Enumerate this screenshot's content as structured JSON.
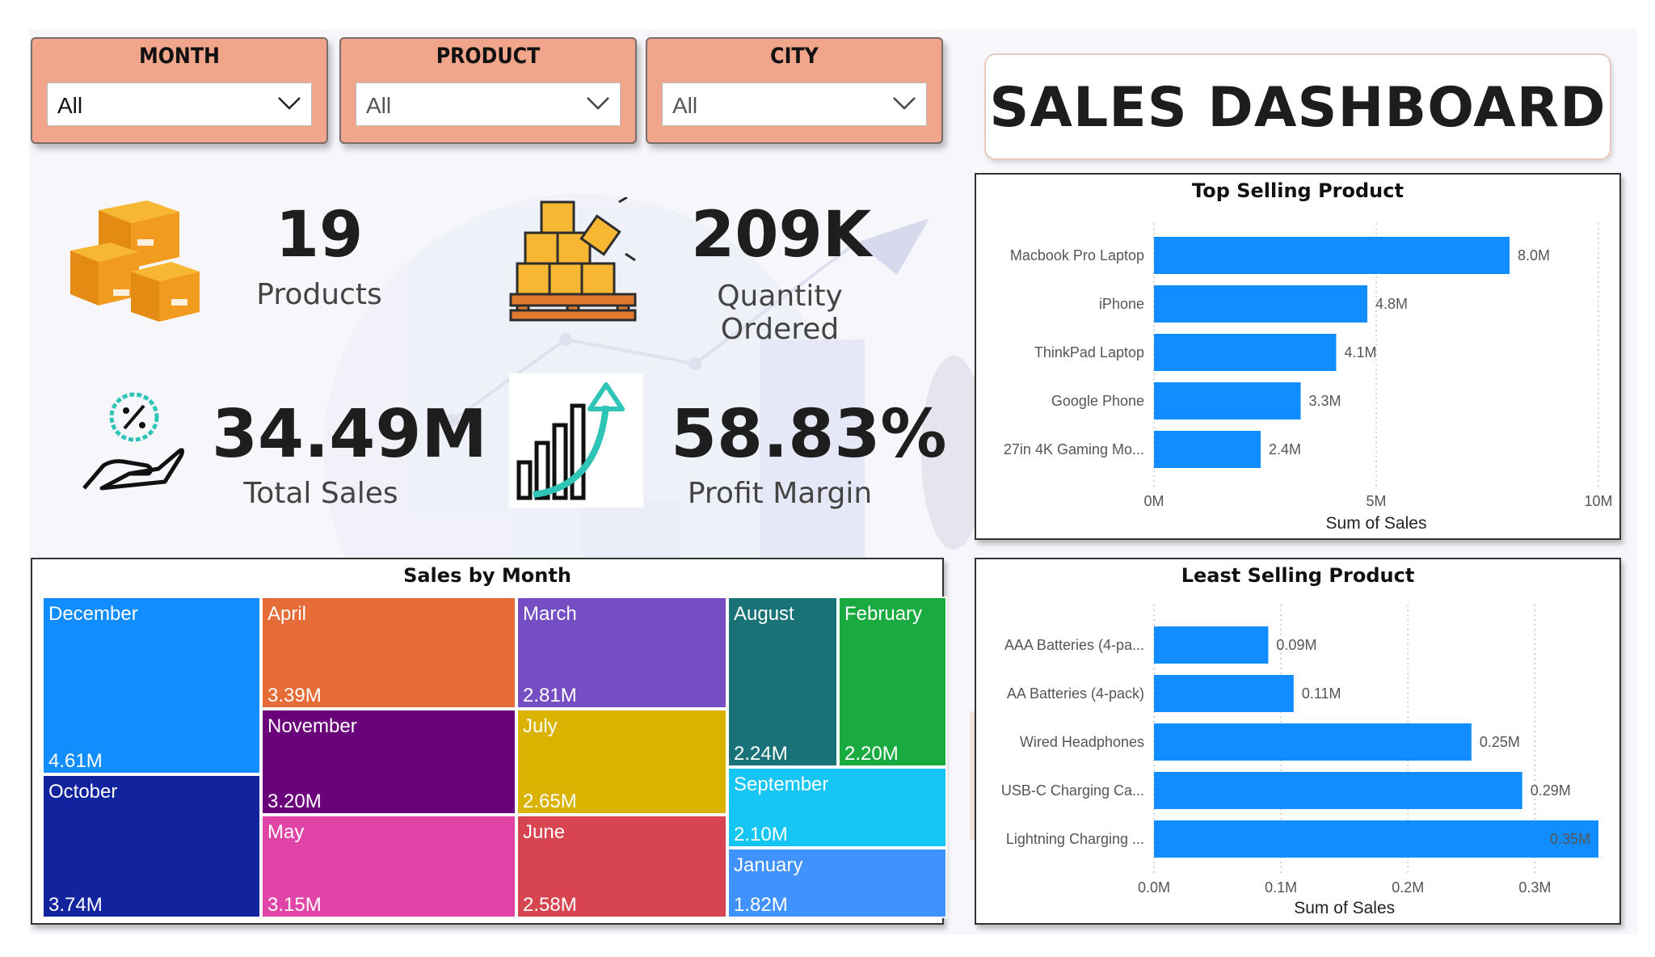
{
  "filters": [
    {
      "title": "MONTH",
      "value": "All"
    },
    {
      "title": "PRODUCT",
      "value": "All"
    },
    {
      "title": "CITY",
      "value": "All"
    }
  ],
  "dashboard_title": "SALES DASHBOARD",
  "kpis": {
    "products": {
      "value": "19",
      "label": "Products",
      "icon": "boxes-icon"
    },
    "quantity": {
      "value": "209K",
      "label": "Quantity Ordered",
      "icon": "pallet-boxes-icon"
    },
    "sales": {
      "value": "34.49M",
      "label": "Total Sales",
      "icon": "hand-percent-icon"
    },
    "margin": {
      "value": "58.83%",
      "label": "Profit Margin",
      "icon": "growth-chart-icon"
    }
  },
  "colors": {
    "accent": "#f1a58b",
    "bar": "#118dff"
  },
  "chart_data": [
    {
      "type": "bar",
      "orientation": "horizontal",
      "title": "Top Selling Product",
      "xlabel": "Sum of Sales",
      "categories": [
        "Macbook Pro Laptop",
        "iPhone",
        "ThinkPad Laptop",
        "Google Phone",
        "27in 4K Gaming Mo..."
      ],
      "values": [
        8.0,
        4.8,
        4.1,
        3.3,
        2.4
      ],
      "value_labels": [
        "8.0M",
        "4.8M",
        "4.1M",
        "3.3M",
        "2.4M"
      ],
      "xticks": [
        "0M",
        "5M",
        "10M"
      ],
      "xlim": [
        0,
        10
      ],
      "grid": true
    },
    {
      "type": "bar",
      "orientation": "horizontal",
      "title": "Least Selling Product",
      "xlabel": "Sum of Sales",
      "categories": [
        "AAA Batteries (4-pa...",
        "AA Batteries (4-pack)",
        "Wired Headphones",
        "USB-C Charging Ca...",
        "Lightning Charging ..."
      ],
      "values": [
        0.09,
        0.11,
        0.25,
        0.29,
        0.35
      ],
      "value_labels": [
        "0.09M",
        "0.11M",
        "0.25M",
        "0.29M",
        "0.35M"
      ],
      "xticks": [
        "0.0M",
        "0.1M",
        "0.2M",
        "0.3M"
      ],
      "xlim": [
        0,
        0.35
      ],
      "grid": true
    },
    {
      "type": "treemap",
      "title": "Sales by Month",
      "items": [
        {
          "name": "December",
          "label": "4.61M",
          "value": 4.61,
          "color": "#118dff"
        },
        {
          "name": "October",
          "label": "3.74M",
          "value": 3.74,
          "color": "#12239e"
        },
        {
          "name": "April",
          "label": "3.39M",
          "value": 3.39,
          "color": "#e66c37"
        },
        {
          "name": "November",
          "label": "3.20M",
          "value": 3.2,
          "color": "#6b007b"
        },
        {
          "name": "May",
          "label": "3.15M",
          "value": 3.15,
          "color": "#e044a7"
        },
        {
          "name": "March",
          "label": "2.81M",
          "value": 2.81,
          "color": "#744ec2"
        },
        {
          "name": "July",
          "label": "2.65M",
          "value": 2.65,
          "color": "#d9b300"
        },
        {
          "name": "June",
          "label": "2.58M",
          "value": 2.58,
          "color": "#d64550"
        },
        {
          "name": "August",
          "label": "2.24M",
          "value": 2.24,
          "color": "#197278"
        },
        {
          "name": "February",
          "label": "2.20M",
          "value": 2.2,
          "color": "#1aab40"
        },
        {
          "name": "September",
          "label": "2.10M",
          "value": 2.1,
          "color": "#15c6f4"
        },
        {
          "name": "January",
          "label": "1.82M",
          "value": 1.82,
          "color": "#4092ff"
        }
      ]
    }
  ]
}
